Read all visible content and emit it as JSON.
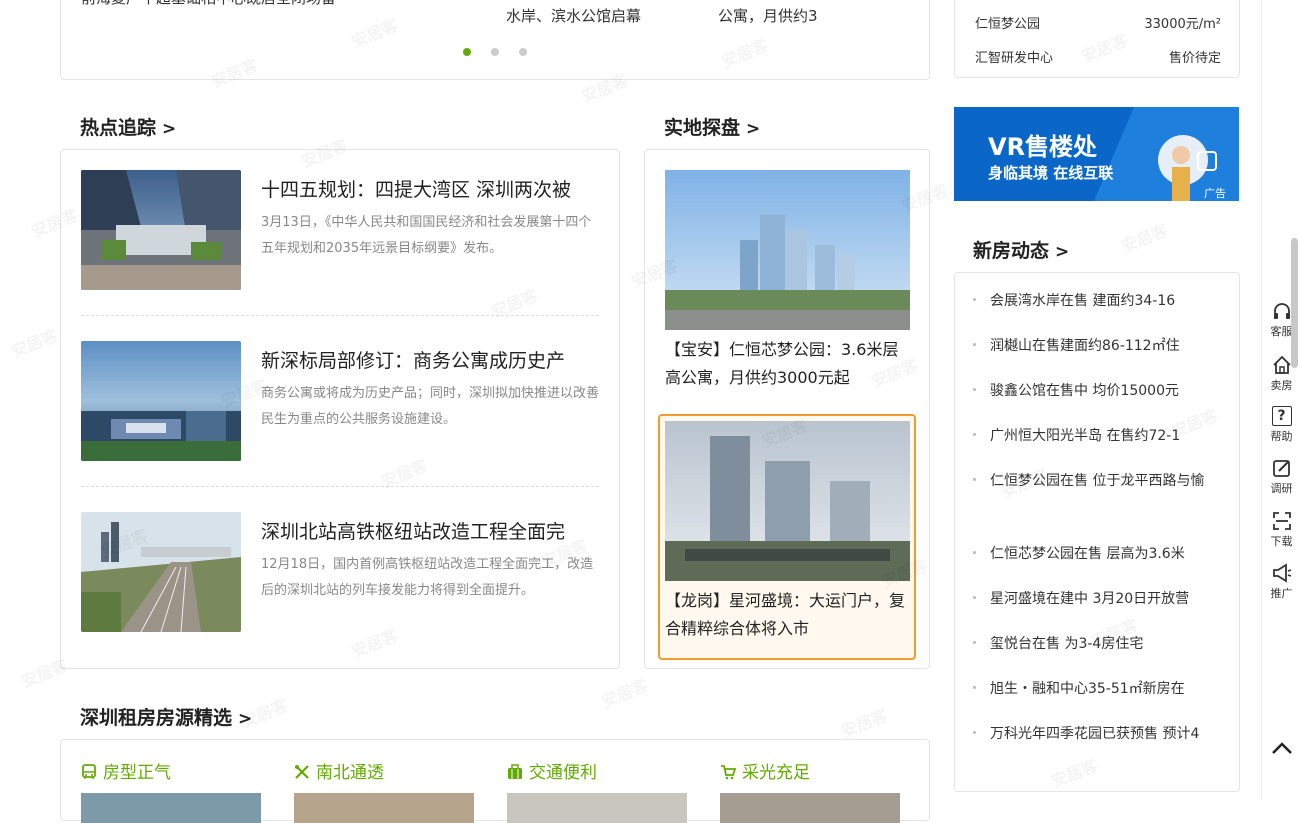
{
  "top_carousel": {
    "left_text": "前海复产丨超基础相中心既居全闭场备",
    "mid_text": "水岸、滨水公馆启幕",
    "right_text": "公寓，月供约3"
  },
  "top_right_list": [
    {
      "name": "仁恒梦公园",
      "price": "33000元/m²"
    },
    {
      "name": "汇智研发中心",
      "price": "售价待定"
    }
  ],
  "hot_news": {
    "title": "热点追踪",
    "arrow": ">",
    "items": [
      {
        "title": "十四五规划：四提大湾区 深圳两次被",
        "desc": "3月13日，《中华人民共和国国民经济和社会发展第十四个五年规划和2035年远景目标纲要》发布。"
      },
      {
        "title": "新深标局部修订：商务公寓成历史产",
        "desc": "商务公寓或将成为历史产品；同时，深圳拟加快推进以改善民生为重点的公共服务设施建设。"
      },
      {
        "title": "深圳北站高铁枢纽站改造工程全面完",
        "desc": "12月18日，国内首例高铁枢纽站改造工程全面完工，改造后的深圳北站的列车接发能力将得到全面提升。"
      }
    ]
  },
  "field_visit": {
    "title": "实地探盘",
    "arrow": ">",
    "items": [
      {
        "text": "【宝安】仁恒芯梦公园：3.6米层高公寓，月供约3000元起"
      },
      {
        "text": "【龙岗】星河盛境：大运门户，复合精粹综合体将入市"
      }
    ]
  },
  "vr_banner": {
    "title": "VR售楼处",
    "subtitle": "身临其境 在线互联",
    "ad": "广告"
  },
  "new_house": {
    "title": "新房动态",
    "arrow": ">",
    "items": [
      "会展湾水岸在售 建面约34-16",
      "润樾山在售建面约86-112㎡住",
      "骏鑫公馆在售中 均价15000元",
      "广州恒大阳光半岛 在售约72-1",
      "仁恒梦公园在售 位于龙平西路与愉",
      "仁恒芯梦公园在售 层高为3.6米",
      "星河盛境在建中 3月20日开放营",
      "玺悦台在售 为3-4房住宅",
      "旭生・融和中心35-51㎡新房在",
      "万科光年四季花园已获预售 预计4"
    ]
  },
  "rent": {
    "title": "深圳租房房源精选",
    "arrow": ">",
    "features": [
      "房型正气",
      "南北通透",
      "交通便利",
      "采光充足"
    ]
  },
  "toolbar": {
    "items": [
      "客服",
      "卖房",
      "帮助",
      "调研",
      "下载",
      "推广"
    ],
    "help_glyph": "?"
  },
  "watermark": "安居客",
  "colors": {
    "accent": "#62ab00",
    "highlight": "#f39b2c",
    "vr_blue": "#0a67c8"
  }
}
